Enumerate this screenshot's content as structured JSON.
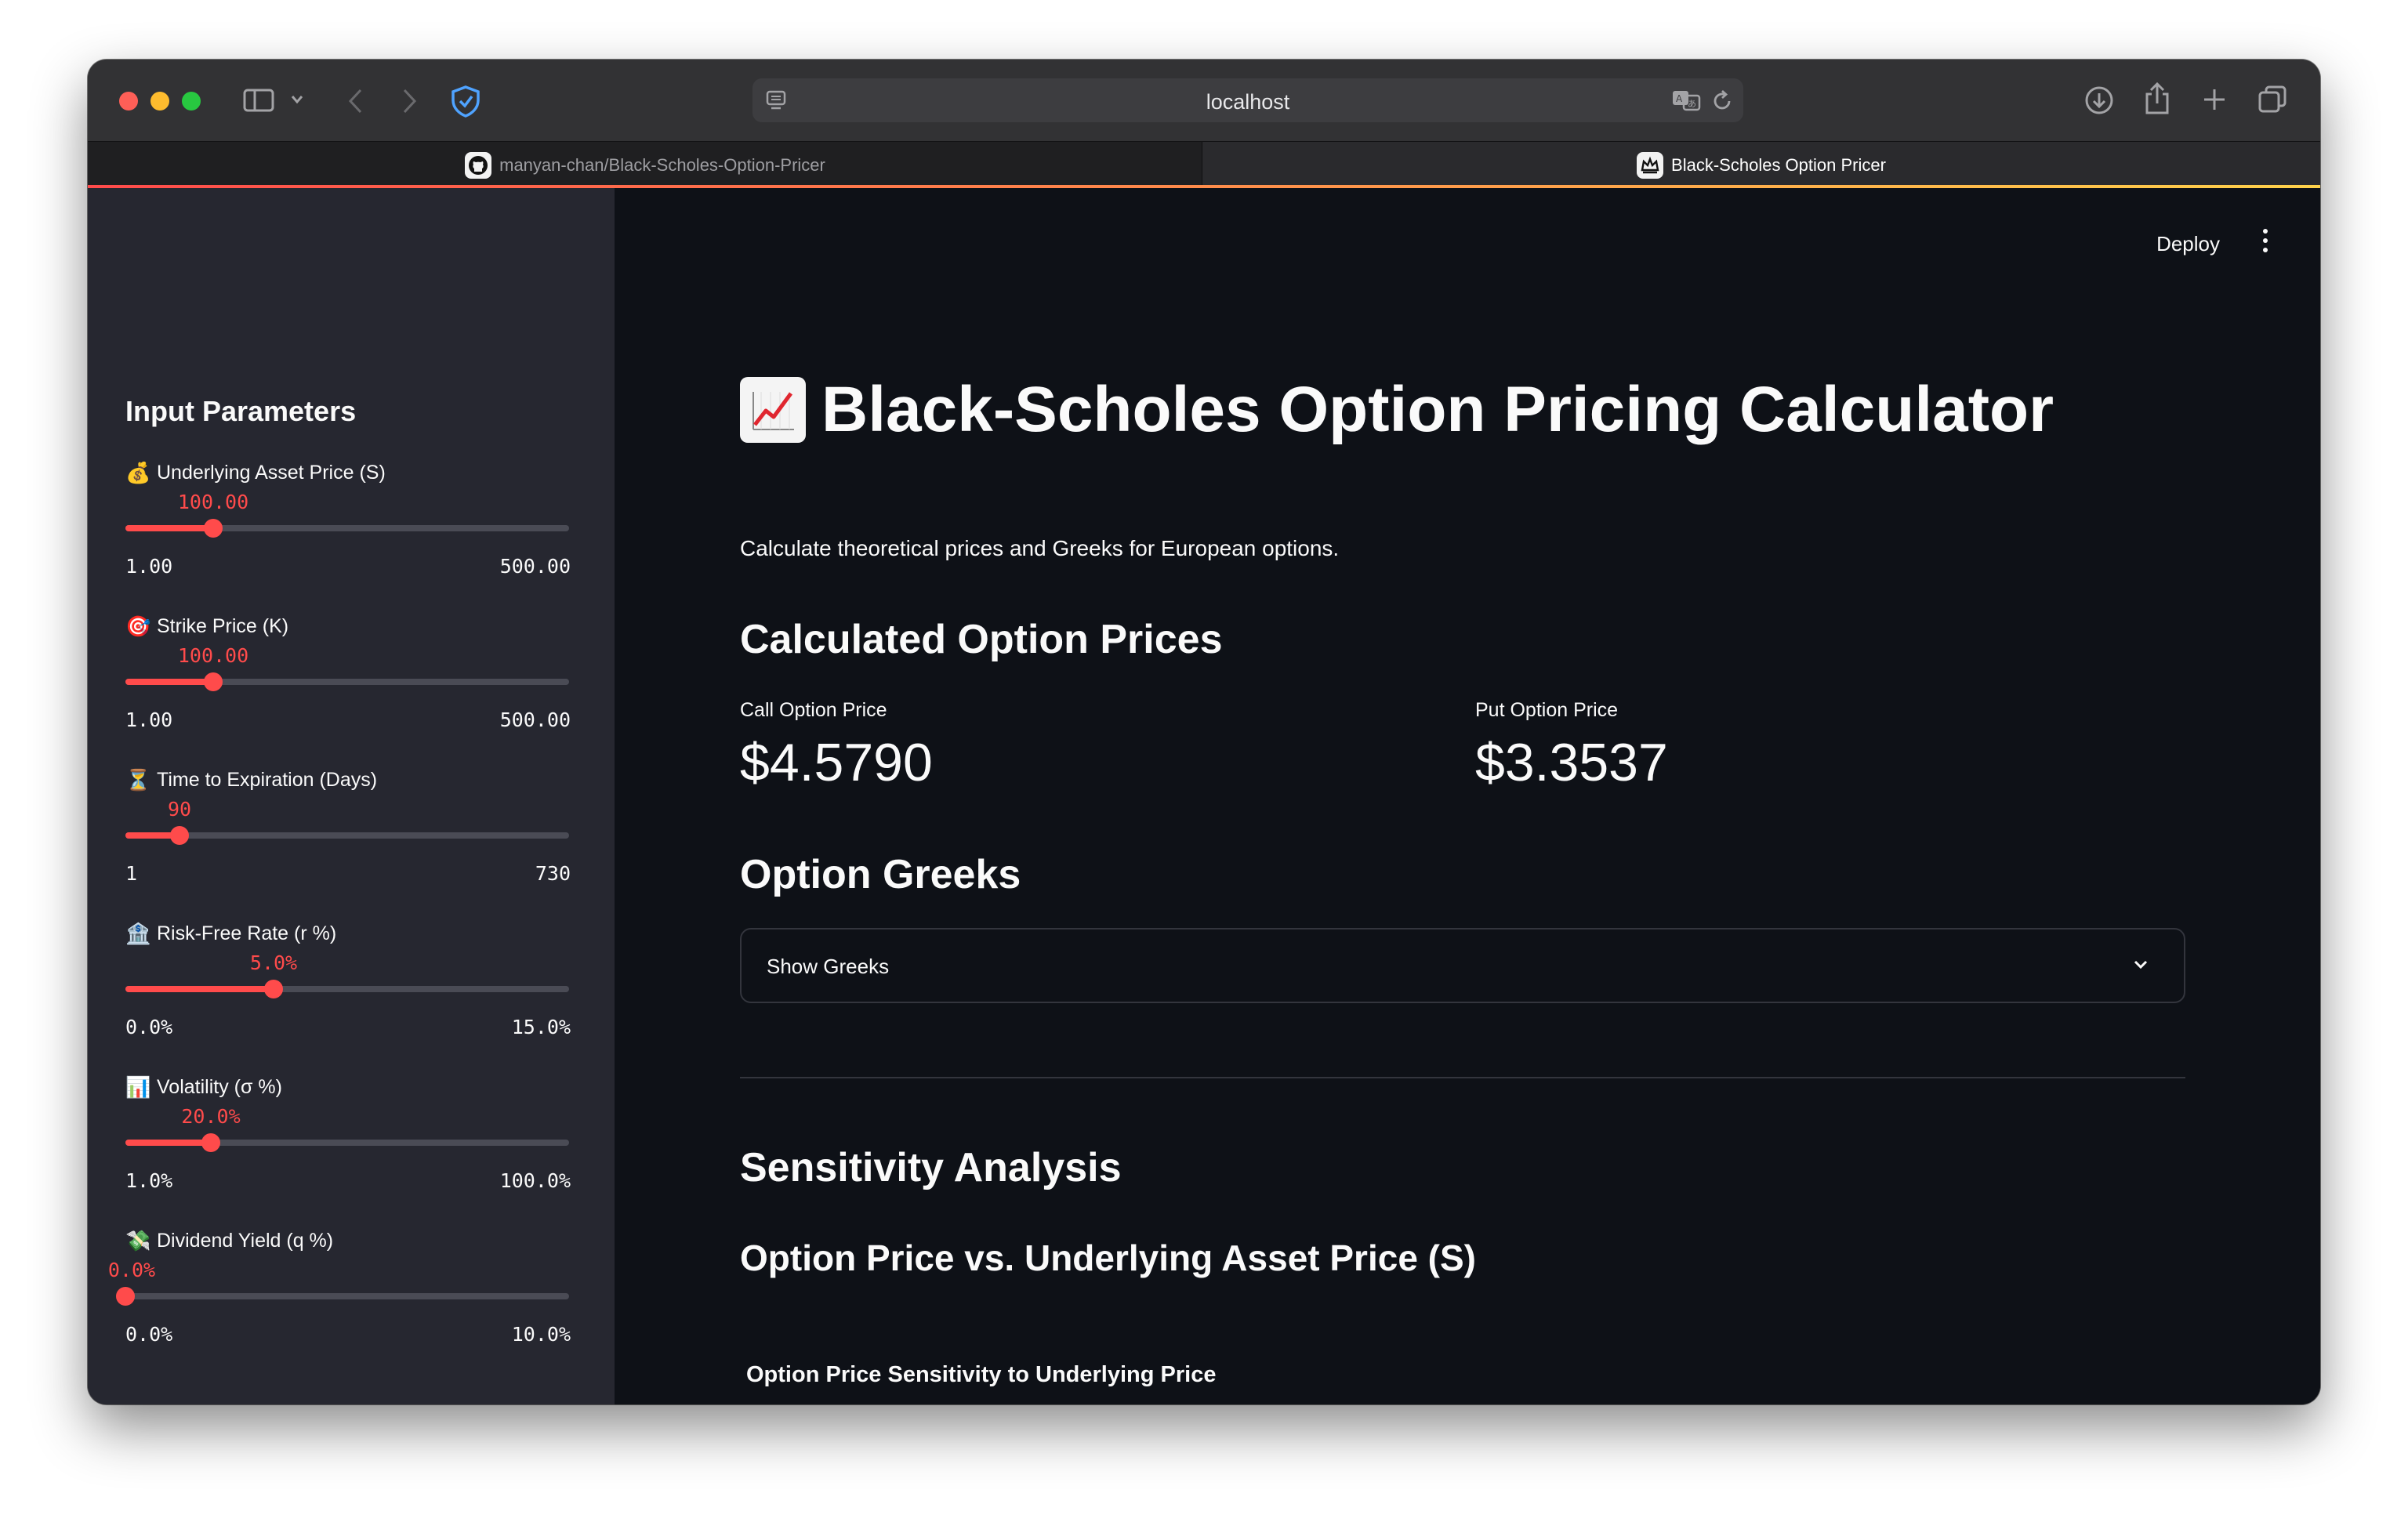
{
  "browser": {
    "url": "localhost",
    "tabs": [
      {
        "label": "manyan-chan/Black-Scholes-Option-Pricer",
        "active": false,
        "icon": "github-icon"
      },
      {
        "label": "Black-Scholes Option Pricer",
        "active": true,
        "icon": "streamlit-crown-icon"
      }
    ]
  },
  "header": {
    "deploy_label": "Deploy",
    "menu_icon": "kebab-menu-icon"
  },
  "sidebar": {
    "title": "Input Parameters",
    "sliders": [
      {
        "emoji": "💰",
        "label": "Underlying Asset Price (S)",
        "value": "100.00",
        "min": "1.00",
        "max": "500.00",
        "fraction": 0.1984
      },
      {
        "emoji": "🎯",
        "label": "Strike Price (K)",
        "value": "100.00",
        "min": "1.00",
        "max": "500.00",
        "fraction": 0.1984
      },
      {
        "emoji": "⏳",
        "label": "Time to Expiration (Days)",
        "value": "90",
        "min": "1",
        "max": "730",
        "fraction": 0.1221
      },
      {
        "emoji": "🏦",
        "label": "Risk-Free Rate (r %)",
        "value": "5.0%",
        "min": "0.0%",
        "max": "15.0%",
        "fraction": 0.3333
      },
      {
        "emoji": "📊",
        "label": "Volatility (σ %)",
        "value": "20.0%",
        "min": "1.0%",
        "max": "100.0%",
        "fraction": 0.1919
      },
      {
        "emoji": "💸",
        "label": "Dividend Yield (q %)",
        "value": "0.0%",
        "min": "0.0%",
        "max": "10.0%",
        "fraction": 0.0
      }
    ]
  },
  "main": {
    "title": "Black-Scholes Option Pricing Calculator",
    "title_icon": "chart-increasing-icon",
    "subtitle": "Calculate theoretical prices and Greeks for European options.",
    "prices_heading": "Calculated Option Prices",
    "call_label": "Call Option Price",
    "call_value": "$4.5790",
    "put_label": "Put Option Price",
    "put_value": "$3.3537",
    "greeks_heading": "Option Greeks",
    "greeks_expander": "Show Greeks",
    "sensitivity_heading": "Sensitivity Analysis",
    "sensitivity_subheading": "Option Price vs. Underlying Asset Price (S)",
    "plot_title": "Option Price Sensitivity to Underlying Price"
  },
  "colors": {
    "accent": "#ff4b4b",
    "background": "#0e1117",
    "sidebar": "#262730",
    "text": "#fafafa"
  }
}
